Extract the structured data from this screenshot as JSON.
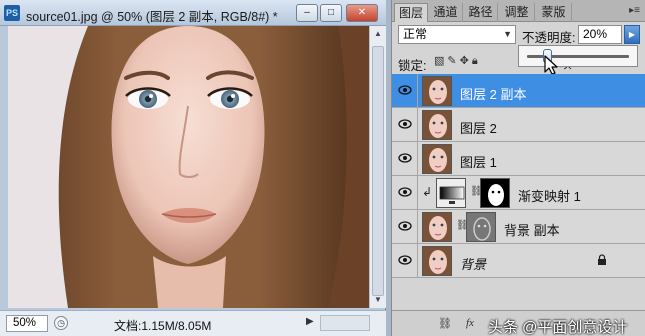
{
  "document": {
    "app_icon": "PS",
    "title": "source01.jpg @ 50% (图层 2 副本, RGB/8#) *",
    "window_buttons": {
      "minimize": "–",
      "maximize": "□",
      "close": "✕"
    },
    "zoom": "50%",
    "info": "文档:1.15M/8.05M"
  },
  "layers_panel": {
    "tabs": [
      "图层",
      "通道",
      "路径",
      "调整",
      "蒙版"
    ],
    "active_tab": "图层",
    "blend_mode": "正常",
    "opacity_label": "不透明度:",
    "opacity_value": "20%",
    "opacity_fraction": 0.2,
    "lock_label": "锁定:",
    "fill_partial": "填",
    "layers": [
      {
        "name": "图层 2 副本",
        "visible": true,
        "selected": true,
        "type": "photo"
      },
      {
        "name": "图层 2",
        "visible": true,
        "selected": false,
        "type": "photo"
      },
      {
        "name": "图层 1",
        "visible": true,
        "selected": false,
        "type": "photo"
      },
      {
        "name": "渐变映射 1",
        "visible": true,
        "selected": false,
        "type": "adjustment"
      },
      {
        "name": "背景 副本",
        "visible": true,
        "selected": false,
        "type": "masked"
      },
      {
        "name": "背景",
        "visible": true,
        "selected": false,
        "type": "background",
        "locked": true
      }
    ],
    "watermark": "头条 @平面创意设计"
  },
  "colors": {
    "selection": "#3e8fe4",
    "panel_bg": "#d4d4d4",
    "chrome": "#b9c9db"
  }
}
